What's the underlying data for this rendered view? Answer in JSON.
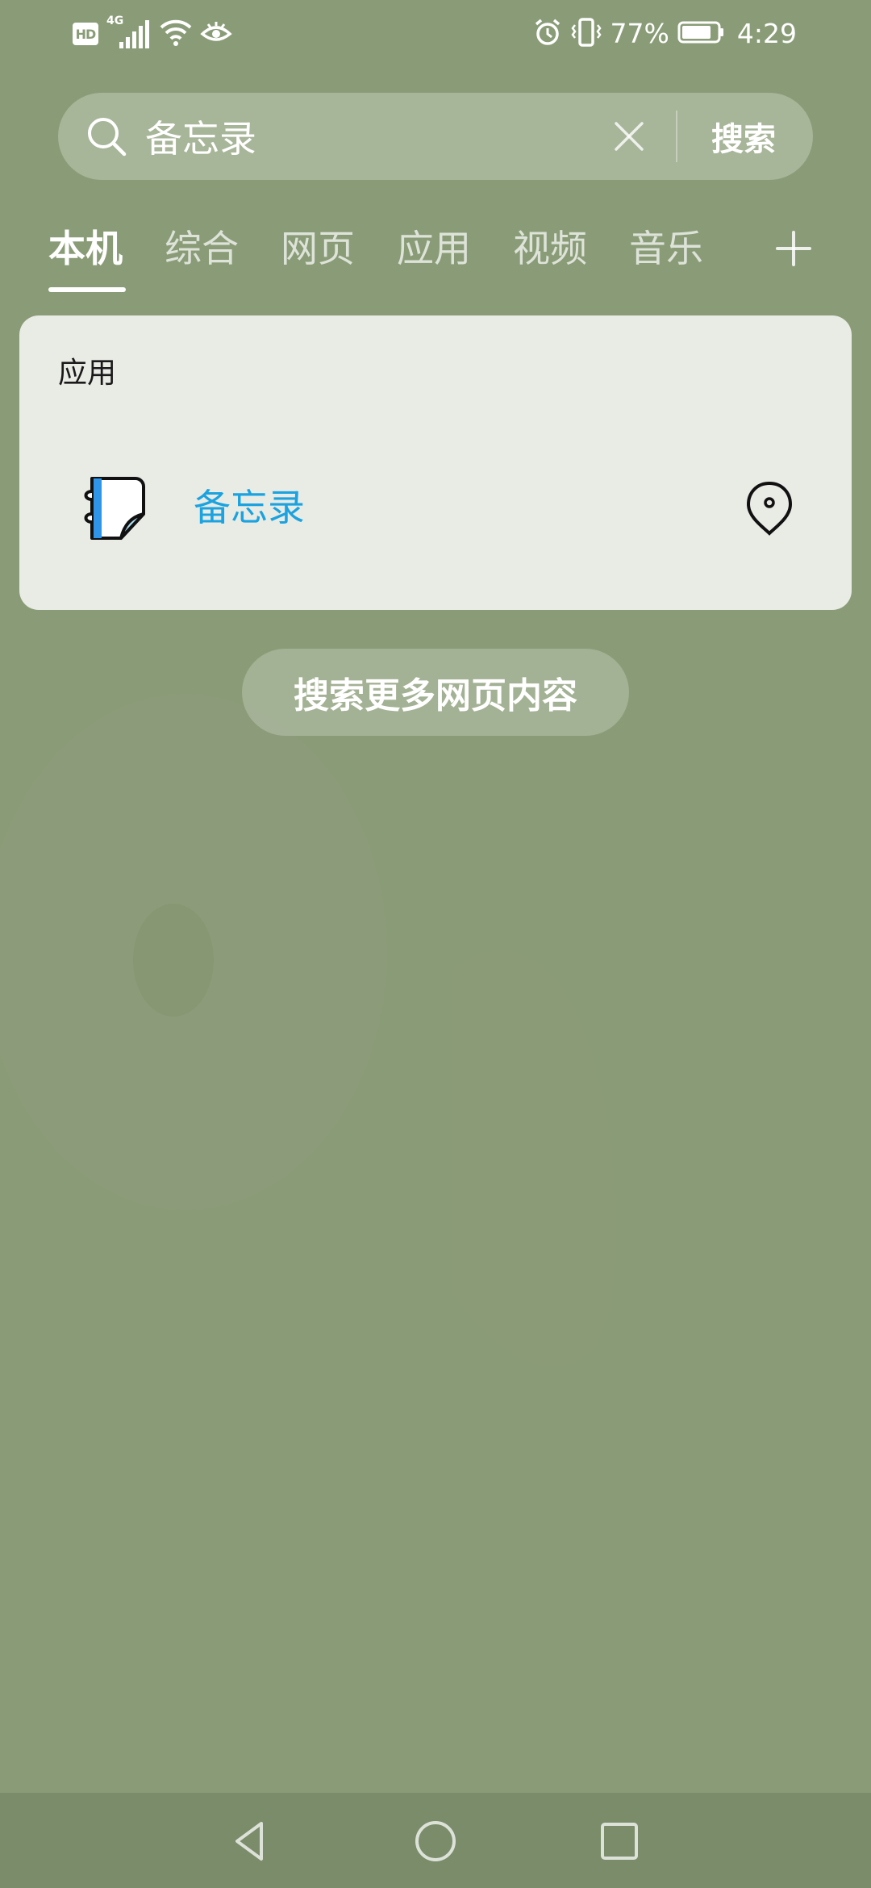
{
  "status_bar": {
    "hd_label": "HD",
    "network_label": "4G",
    "battery_percent": "77%",
    "time": "4:29",
    "icons": [
      "hd-badge",
      "signal-icon",
      "wifi-icon",
      "eye-icon",
      "alarm-icon",
      "vibrate-icon",
      "battery-icon"
    ]
  },
  "search": {
    "query": "备忘录",
    "button_label": "搜索",
    "icons": [
      "search-icon",
      "clear-icon"
    ]
  },
  "tabs": [
    {
      "label": "本机",
      "active": true
    },
    {
      "label": "综合",
      "active": false
    },
    {
      "label": "网页",
      "active": false
    },
    {
      "label": "应用",
      "active": false
    },
    {
      "label": "视频",
      "active": false
    },
    {
      "label": "音乐",
      "active": false
    }
  ],
  "tab_add_icon": "plus-icon",
  "results": {
    "section_title": "应用",
    "apps": [
      {
        "name": "备忘录",
        "icon": "memo-app-icon",
        "action_icon": "location-icon"
      }
    ]
  },
  "search_more_label": "搜索更多网页内容",
  "nav_bar": {
    "icons": [
      "nav-back-icon",
      "nav-home-icon",
      "nav-recent-icon"
    ]
  },
  "colors": {
    "background": "#8a9c77",
    "card": "#e9ebe5",
    "app_name": "#1aa3e0",
    "nav_bar": "#7a8c69"
  }
}
